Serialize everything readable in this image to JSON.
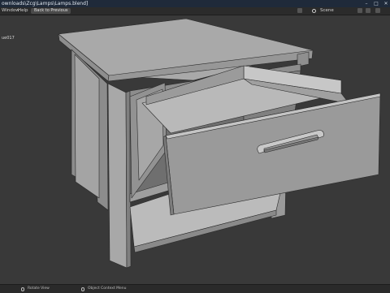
{
  "window": {
    "title": "ownloads\\Zcg\\Lamps\\Lamps.blend]",
    "min": "–",
    "max": "□",
    "close": "✕"
  },
  "menu": {
    "items": [
      "Window",
      "Help"
    ],
    "back_button": "Back to Previous",
    "scene": "Scene"
  },
  "viewport": {
    "object_label": "ue017"
  },
  "status": {
    "rotate": "Rotate View",
    "context": "Object Context Menu"
  },
  "colors": {
    "background": "#393939",
    "model_light": "#b3b3b3",
    "model_mid": "#9a9a9a",
    "model_dark": "#7b7b7b",
    "wire": "#2a2a2a"
  }
}
